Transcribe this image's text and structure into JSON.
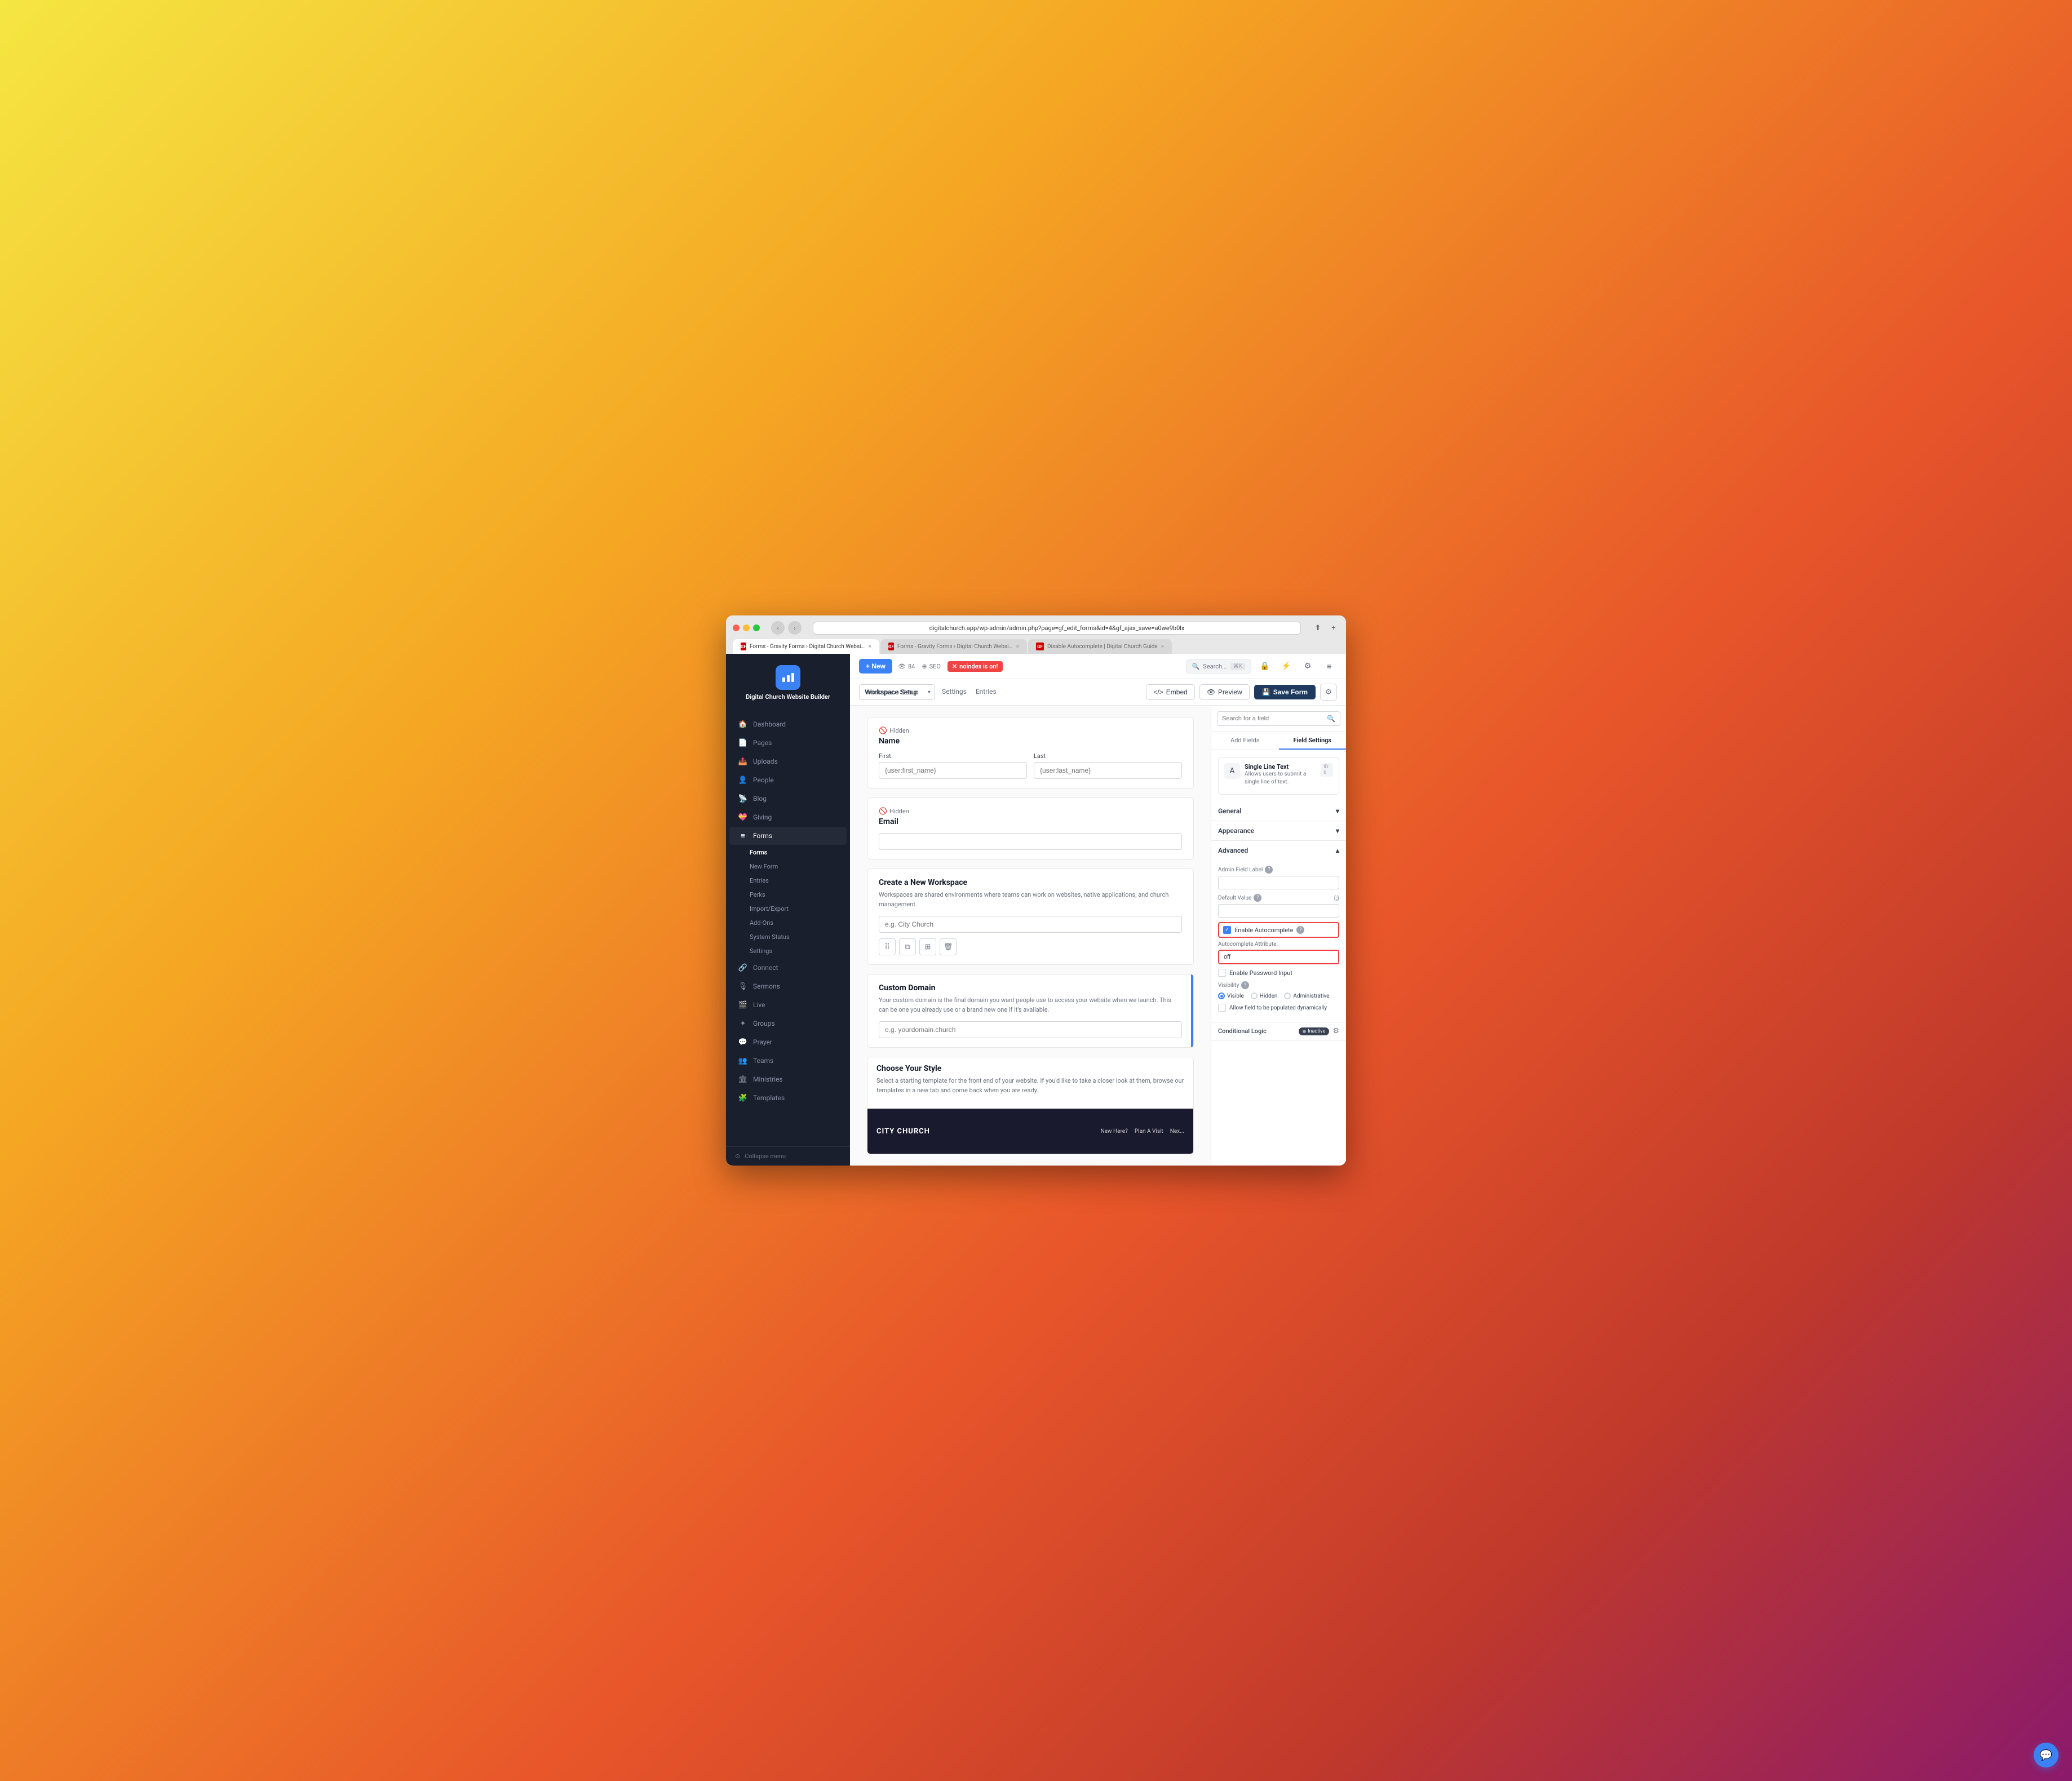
{
  "browser": {
    "url": "digitalchurch.app/wp-admin/admin.php?page=gf_edit_forms&id=4&gf_ajax_save=a0we9b0lx",
    "tabs": [
      {
        "label": "Forms - Gravity Forms › Digital Church Website Builder — DigitalChurch",
        "favicon": "GF",
        "active": true
      },
      {
        "label": "Forms - Gravity Forms › Digital Church Website Builder — DigitalChurch",
        "favicon": "GF",
        "active": false
      },
      {
        "label": "Disable Autocomplete | Digital Church Guide",
        "favicon": "GF",
        "active": false
      }
    ],
    "search_placeholder": "Search..."
  },
  "top_toolbar": {
    "new_label": "+ New",
    "entries_count": "84",
    "seo_label": "SEO",
    "noindex_label": "noindex is on!",
    "search_placeholder": "Search...",
    "search_shortcut": "⌘K"
  },
  "form_toolbar": {
    "workspace_select": "Workspace Setup",
    "nav_links": [
      "Settings",
      "Entries"
    ],
    "embed_label": "Embed",
    "preview_label": "Preview",
    "save_label": "Save Form",
    "settings_label": "⚙"
  },
  "sidebar": {
    "logo_text": "Digital Church Website\nBuilder",
    "items": [
      {
        "icon": "🏠",
        "label": "Dashboard"
      },
      {
        "icon": "📄",
        "label": "Pages"
      },
      {
        "icon": "📤",
        "label": "Uploads"
      },
      {
        "icon": "👤",
        "label": "People"
      },
      {
        "icon": "📡",
        "label": "Blog"
      },
      {
        "icon": "💝",
        "label": "Giving"
      },
      {
        "icon": "≡",
        "label": "Forms",
        "active": true,
        "expanded": true
      },
      {
        "icon": "🔗",
        "label": "Connect"
      },
      {
        "icon": "🎙",
        "label": "Sermons"
      },
      {
        "icon": "🎬",
        "label": "Live"
      },
      {
        "icon": "✦",
        "label": "Groups"
      },
      {
        "icon": "💬",
        "label": "Prayer"
      },
      {
        "icon": "👥",
        "label": "Teams"
      },
      {
        "icon": "🏛",
        "label": "Ministries"
      },
      {
        "icon": "🧩",
        "label": "Templates"
      }
    ],
    "forms_sub_items": [
      {
        "label": "Forms",
        "active": true
      },
      {
        "label": "New Form"
      },
      {
        "label": "Entries"
      },
      {
        "label": "Perks"
      },
      {
        "label": "Import/Export"
      },
      {
        "label": "Add-Ons"
      },
      {
        "label": "System Status"
      },
      {
        "label": "Settings"
      }
    ],
    "collapse_label": "Collapse menu"
  },
  "form_editor": {
    "hidden_name_badge": "Hidden",
    "name_label": "Name",
    "first_sublabel": "First",
    "last_sublabel": "Last",
    "first_placeholder": "{user:first_name}",
    "last_placeholder": "{user:last_name}",
    "hidden_email_badge": "Hidden",
    "email_label": "Email",
    "create_workspace_title": "Create a New Workspace",
    "create_workspace_desc": "Workspaces are shared environments where teams can work on websites, native applications, and church management.",
    "workspace_placeholder": "e.g. City Church",
    "custom_domain_title": "Custom Domain",
    "custom_domain_desc": "Your custom domain is the final domain you want people use to access your website when we launch. This can be one you already use or a brand new one if it's available.",
    "domain_placeholder": "e.g. yourdomain.church",
    "choose_style_title": "Choose Your Style",
    "choose_style_desc": "Select a starting template for the front end of your website. If you'd like to take a closer look at them, browse our templates in a new tab and come back when you are ready.",
    "style_preview_logo": "CITY CHURCH",
    "style_preview_nav": [
      "New Here?",
      "Plan A Visit",
      "Nex..."
    ]
  },
  "right_panel": {
    "search_placeholder": "Search for a field",
    "tabs": [
      "Add Fields",
      "Field Settings"
    ],
    "active_tab": "Field Settings",
    "field_type": {
      "name": "Single Line Text",
      "id_label": "ID: 6",
      "description": "Allows users to submit a single line of text.",
      "icon": "A"
    },
    "sections": {
      "general": {
        "label": "General",
        "expanded": false
      },
      "appearance": {
        "label": "Appearance",
        "expanded": false
      },
      "advanced": {
        "label": "Advanced",
        "expanded": true,
        "admin_field_label": "Admin Field Label",
        "admin_field_label_placeholder": "",
        "admin_help_label": "?",
        "default_value": "Default Value",
        "default_value_placeholder": "",
        "default_merge_icon": "{;}",
        "enable_autocomplete_label": "Enable Autocomplete",
        "enable_autocomplete_help": "?",
        "autocomplete_attribute_label": "Autocomplete Attribute:",
        "autocomplete_attribute_value": "off",
        "enable_password_label": "Enable Password Input",
        "visibility_label": "Visibility",
        "visibility_help": "?",
        "visibility_options": [
          "Visible",
          "Hidden",
          "Administrative"
        ],
        "visibility_selected": "Visible",
        "allow_dynamic_label": "Allow field to be populated dynamically",
        "conditional_logic_label": "Conditional Logic",
        "conditional_status": "Inactive",
        "conditional_status_dot": "●"
      }
    }
  }
}
